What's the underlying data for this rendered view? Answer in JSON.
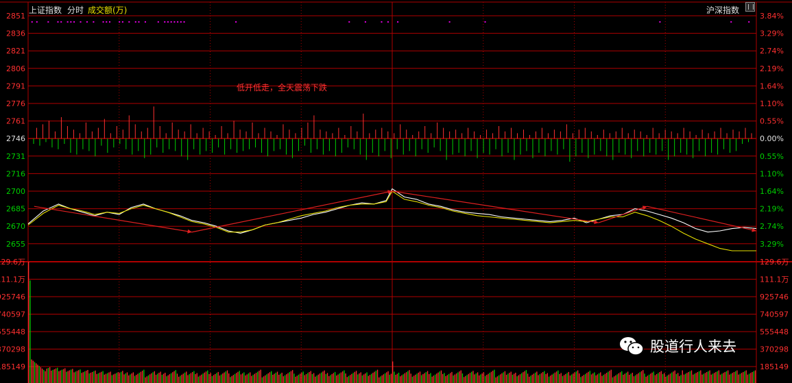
{
  "header": {
    "index_name": "上证指数",
    "period": "分时",
    "sub_indicator": "成交额(万)",
    "right_label": "沪深指数"
  },
  "annotation": "低开低走，全天震荡下跌",
  "watermark": "股道行人来去",
  "colors": {
    "background": "#000000",
    "grid": "#b00000",
    "up": "#ff3030",
    "down": "#00d000",
    "price_line": "#ffffff",
    "avg_line": "#e8e000",
    "trend": "#e02020",
    "marker": "#e000e0"
  },
  "chart_data": [
    {
      "type": "line",
      "title": "上证指数 分时",
      "y_left_ticks": [
        "2851",
        "2836",
        "2821",
        "2806",
        "2791",
        "2776",
        "2761",
        "2746",
        "2731",
        "2716",
        "2700",
        "2685",
        "2670",
        "2655"
      ],
      "y_right_ticks": [
        "3.84%",
        "3.29%",
        "2.74%",
        "2.19%",
        "1.64%",
        "1.10%",
        "0.55%",
        "0.00%",
        "0.55%",
        "1.10%",
        "1.64%",
        "2.19%",
        "2.74%",
        "3.29%"
      ],
      "prev_close": 2746,
      "ylim": [
        2647,
        2851
      ],
      "x_minutes": 240,
      "series": [
        {
          "name": "price",
          "points": [
            [
              0,
              2673
            ],
            [
              5,
              2684
            ],
            [
              10,
              2690
            ],
            [
              14,
              2686
            ],
            [
              18,
              2683
            ],
            [
              22,
              2680
            ],
            [
              26,
              2683
            ],
            [
              30,
              2681
            ],
            [
              34,
              2687
            ],
            [
              38,
              2690
            ],
            [
              42,
              2686
            ],
            [
              46,
              2683
            ],
            [
              50,
              2680
            ],
            [
              54,
              2676
            ],
            [
              58,
              2674
            ],
            [
              62,
              2671
            ],
            [
              66,
              2667
            ],
            [
              70,
              2665
            ],
            [
              74,
              2668
            ],
            [
              78,
              2672
            ],
            [
              82,
              2674
            ],
            [
              86,
              2676
            ],
            [
              90,
              2678
            ],
            [
              94,
              2681
            ],
            [
              98,
              2683
            ],
            [
              102,
              2686
            ],
            [
              106,
              2689
            ],
            [
              110,
              2691
            ],
            [
              114,
              2690
            ],
            [
              118,
              2693
            ],
            [
              120,
              2703
            ],
            [
              124,
              2696
            ],
            [
              128,
              2694
            ],
            [
              132,
              2690
            ],
            [
              136,
              2688
            ],
            [
              140,
              2685
            ],
            [
              144,
              2683
            ],
            [
              148,
              2682
            ],
            [
              152,
              2681
            ],
            [
              156,
              2679
            ],
            [
              160,
              2678
            ],
            [
              164,
              2677
            ],
            [
              168,
              2676
            ],
            [
              172,
              2675
            ],
            [
              176,
              2676
            ],
            [
              180,
              2678
            ],
            [
              184,
              2674
            ],
            [
              188,
              2677
            ],
            [
              192,
              2680
            ],
            [
              196,
              2681
            ],
            [
              200,
              2686
            ],
            [
              204,
              2684
            ],
            [
              208,
              2681
            ],
            [
              212,
              2678
            ],
            [
              216,
              2674
            ],
            [
              220,
              2669
            ],
            [
              224,
              2666
            ],
            [
              228,
              2667
            ],
            [
              232,
              2669
            ],
            [
              236,
              2670
            ],
            [
              240,
              2669
            ]
          ]
        },
        {
          "name": "average",
          "points": [
            [
              0,
              2672
            ],
            [
              5,
              2682
            ],
            [
              10,
              2689
            ],
            [
              14,
              2686
            ],
            [
              18,
              2684
            ],
            [
              22,
              2681
            ],
            [
              26,
              2683
            ],
            [
              30,
              2682
            ],
            [
              34,
              2686
            ],
            [
              38,
              2689
            ],
            [
              42,
              2686
            ],
            [
              46,
              2683
            ],
            [
              50,
              2679
            ],
            [
              54,
              2675
            ],
            [
              58,
              2673
            ],
            [
              62,
              2670
            ],
            [
              66,
              2666
            ],
            [
              70,
              2666
            ],
            [
              74,
              2668
            ],
            [
              78,
              2672
            ],
            [
              82,
              2674
            ],
            [
              86,
              2677
            ],
            [
              90,
              2680
            ],
            [
              94,
              2682
            ],
            [
              98,
              2684
            ],
            [
              102,
              2687
            ],
            [
              106,
              2689
            ],
            [
              110,
              2690
            ],
            [
              114,
              2690
            ],
            [
              118,
              2692
            ],
            [
              120,
              2701
            ],
            [
              124,
              2694
            ],
            [
              128,
              2692
            ],
            [
              132,
              2689
            ],
            [
              136,
              2687
            ],
            [
              140,
              2684
            ],
            [
              144,
              2682
            ],
            [
              148,
              2680
            ],
            [
              152,
              2679
            ],
            [
              156,
              2678
            ],
            [
              160,
              2677
            ],
            [
              164,
              2676
            ],
            [
              168,
              2675
            ],
            [
              172,
              2674
            ],
            [
              176,
              2675
            ],
            [
              180,
              2676
            ],
            [
              184,
              2675
            ],
            [
              188,
              2677
            ],
            [
              192,
              2679
            ],
            [
              196,
              2679
            ],
            [
              200,
              2683
            ],
            [
              204,
              2680
            ],
            [
              208,
              2676
            ],
            [
              212,
              2671
            ],
            [
              216,
              2665
            ],
            [
              220,
              2660
            ],
            [
              224,
              2656
            ],
            [
              228,
              2652
            ],
            [
              232,
              2650
            ],
            [
              236,
              2650
            ],
            [
              240,
              2650
            ]
          ]
        }
      ],
      "trend_lines": [
        [
          [
            2,
            2688
          ],
          [
            54,
            2666
          ]
        ],
        [
          [
            54,
            2666
          ],
          [
            120,
            2701
          ]
        ],
        [
          [
            120,
            2701
          ],
          [
            188,
            2674
          ]
        ],
        [
          [
            188,
            2674
          ],
          [
            204,
            2688
          ]
        ],
        [
          [
            204,
            2688
          ],
          [
            240,
            2667
          ]
        ]
      ],
      "bias_bars": [
        0,
        -3,
        6,
        -4,
        8,
        -2,
        10,
        -5,
        4,
        -6,
        12,
        -3,
        7,
        -8,
        5,
        -9,
        3,
        -6,
        9,
        -7,
        4,
        -10,
        6,
        -4,
        11,
        -8,
        3,
        -5,
        7,
        -3,
        5,
        -6,
        13,
        -9,
        8,
        -7,
        4,
        -11,
        6,
        -9,
        18,
        -5,
        7,
        -8,
        3,
        -6,
        9,
        -7,
        5,
        -10,
        4,
        -12,
        8,
        -6,
        3,
        -9,
        6,
        -7,
        4,
        -8,
        2,
        -5,
        7,
        -9,
        3,
        -6,
        10,
        -8,
        5,
        -7,
        4,
        -6,
        9,
        -5,
        3,
        -8,
        6,
        -10,
        4,
        -7,
        2,
        -6,
        8,
        -9,
        5,
        -11,
        3,
        -7,
        6,
        -4,
        9,
        -8,
        13,
        -6,
        5,
        -9,
        4,
        -7,
        3,
        -10,
        6,
        -8,
        2,
        -5,
        7,
        -6,
        4,
        -9,
        14,
        -12,
        3,
        -8,
        5,
        -10,
        6,
        -7,
        4,
        -11,
        3,
        -6,
        8,
        -9,
        5,
        -7,
        2,
        -10,
        4,
        -6,
        7,
        -8,
        3,
        -5,
        9,
        -7,
        6,
        -12,
        4,
        -9,
        5,
        -8,
        3,
        -10,
        6,
        -7,
        4,
        -11,
        2,
        -8,
        5,
        -9,
        3,
        -6,
        7,
        -10,
        4,
        -8,
        6,
        -12,
        3,
        -9,
        5,
        -7,
        2,
        -11,
        4,
        -8,
        6,
        -10,
        3,
        -7,
        5,
        -9,
        4,
        -6,
        8,
        -13,
        3,
        -10,
        5,
        -8,
        6,
        -11,
        4,
        -9,
        2,
        -7,
        5,
        -10,
        3,
        -12,
        4,
        -8,
        6,
        -9,
        3,
        -11,
        5,
        -7,
        4,
        -10,
        2,
        -8,
        6,
        -9,
        3,
        -7,
        5,
        -12,
        4,
        -10,
        3,
        -8,
        6,
        -9,
        4,
        -11,
        2,
        -7,
        5,
        -10,
        3,
        -8,
        4,
        -9,
        6,
        -6,
        3,
        -8,
        5,
        -7,
        4,
        -3,
        6,
        -2,
        3
      ],
      "marker_positions": [
        2,
        5,
        12,
        18,
        20,
        24,
        26,
        28,
        32,
        36,
        40,
        46,
        48,
        50,
        56,
        58,
        62,
        66,
        68,
        72,
        80,
        84,
        86,
        88,
        90,
        92,
        94,
        96,
        128,
        198,
        208,
        218,
        222,
        228,
        260,
        282,
        390,
        434,
        445
      ],
      "volume_ticks": [
        "129.6万",
        "111.1万",
        "925746",
        "740597",
        "555448",
        "370298",
        "185149"
      ],
      "volume_right_ticks": [
        "129.6万",
        "111.1万",
        "925746",
        "740597",
        "555448",
        "370298",
        "185149"
      ],
      "volume_max": 1296000
    }
  ]
}
